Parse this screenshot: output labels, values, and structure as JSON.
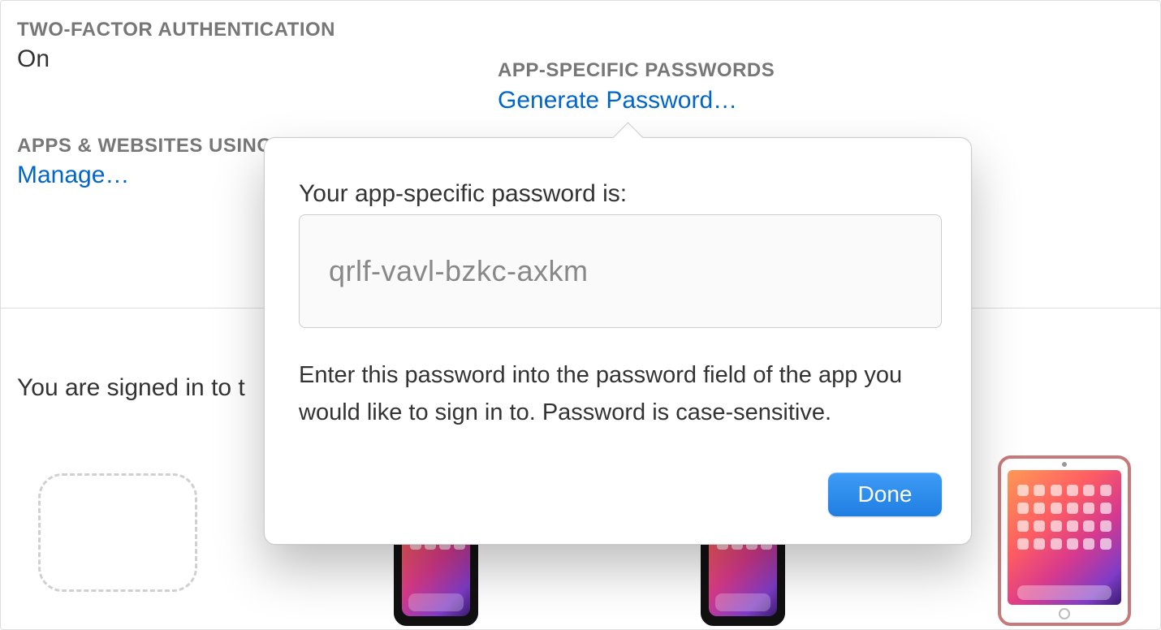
{
  "sections": {
    "tfa": {
      "label": "TWO-FACTOR AUTHENTICATION",
      "value": "On"
    },
    "apps_websites": {
      "label": "APPS & WEBSITES USING APPLE ID",
      "link": "Manage…"
    },
    "asp": {
      "label": "APP-SPECIFIC PASSWORDS",
      "link": "Generate Password…"
    }
  },
  "signed_in_text": "You are signed in to t",
  "popover": {
    "title": "Your app-specific password is:",
    "password": "qrlf-vavl-bzkc-axkm",
    "description": "Enter this password into the password field of the app you would like to sign in to. Password is case-sensitive.",
    "done_label": "Done"
  }
}
